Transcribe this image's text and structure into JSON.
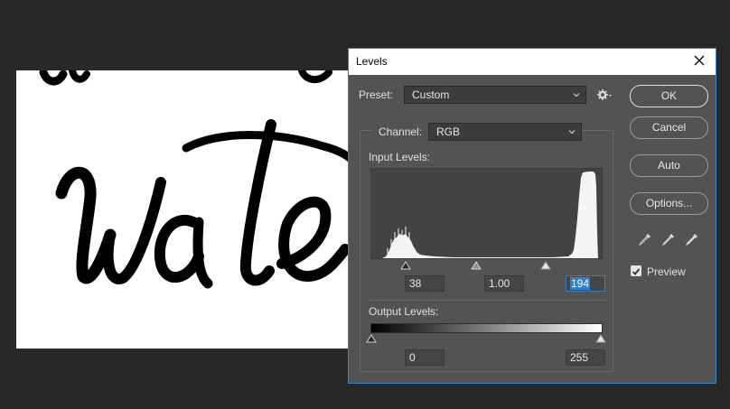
{
  "dialog": {
    "title": "Levels",
    "preset_label": "Preset:",
    "preset_value": "Custom",
    "channel_label": "Channel:",
    "channel_value": "RGB",
    "input_levels_label": "Input Levels:",
    "input_black": "38",
    "input_gamma": "1.00",
    "input_white": "194",
    "output_levels_label": "Output Levels:",
    "output_black": "0",
    "output_white": "255",
    "buttons": {
      "ok": "OK",
      "cancel": "Cancel",
      "auto": "Auto",
      "options": "Options..."
    },
    "preview_label": "Preview",
    "preview_checked": true
  },
  "icons": {
    "close": "close-icon",
    "preset_options": "gear-icon",
    "droppers": [
      "black-point-eyedropper-icon",
      "gray-point-eyedropper-icon",
      "white-point-eyedropper-icon"
    ]
  },
  "colors": {
    "dialog_bg": "#535353",
    "accent": "#3a7fc1",
    "workspace_bg": "#282828"
  }
}
